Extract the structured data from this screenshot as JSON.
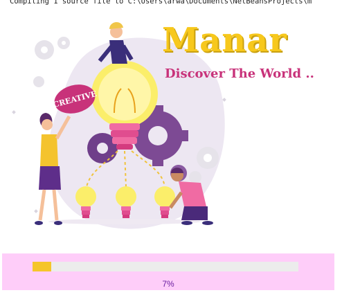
{
  "console_line": "Compiling 1 source file to C:\\Users\\arwa\\Documents\\NetBeansProjects\\m",
  "brand": {
    "title": "Manar",
    "tagline": "Discover The World ..",
    "badge": "CREATIVE"
  },
  "colors": {
    "title": "#f7c81c",
    "tagline": "#c8327a",
    "loader_bg": "#fecdf9",
    "progress_fill": "#f5c52a",
    "progress_track": "#ececec",
    "progress_text": "#6a1fa0"
  },
  "progress": {
    "fraction": 0.07,
    "label": "7%"
  }
}
